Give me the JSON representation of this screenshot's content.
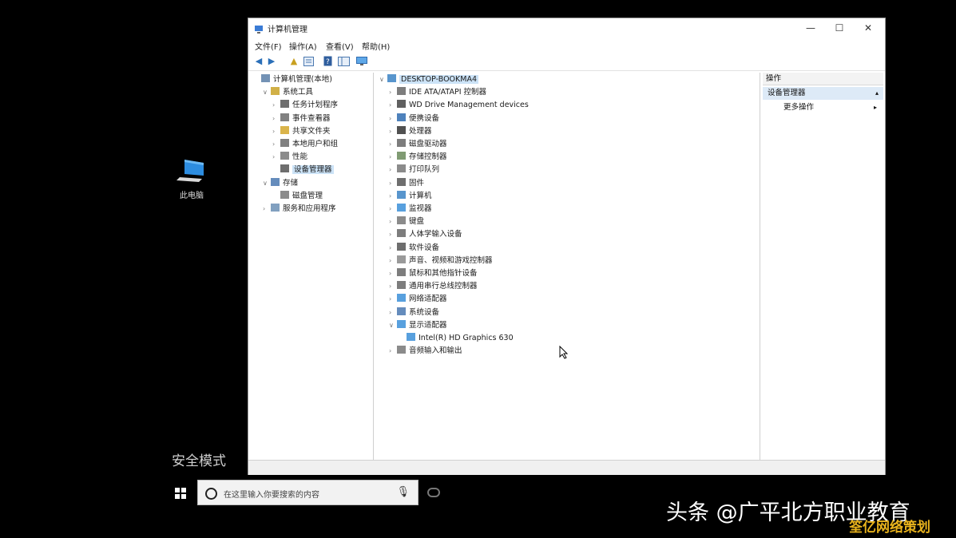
{
  "desktop": {
    "icon_label": "此电脑",
    "safe_mode": "安全模式"
  },
  "window": {
    "title": "计算机管理",
    "controls": {
      "minimize": "—",
      "maximize": "☐",
      "close": "✕"
    },
    "menu": [
      "文件(F)",
      "操作(A)",
      "查看(V)",
      "帮助(H)"
    ],
    "toolbar": [
      "back-icon",
      "forward-icon",
      "up-folder-icon",
      "properties-icon",
      "help-icon",
      "show-hide-tree-icon",
      "monitor-icon"
    ]
  },
  "left_tree": [
    {
      "label": "计算机管理(本地)",
      "indent": 0,
      "arrow": "",
      "icon": "computer-management-icon"
    },
    {
      "label": "系统工具",
      "indent": 1,
      "arrow": "∨",
      "icon": "tools-icon"
    },
    {
      "label": "任务计划程序",
      "indent": 2,
      "arrow": "›",
      "icon": "clock-icon"
    },
    {
      "label": "事件查看器",
      "indent": 2,
      "arrow": "›",
      "icon": "event-viewer-icon"
    },
    {
      "label": "共享文件夹",
      "indent": 2,
      "arrow": "›",
      "icon": "shared-folder-icon"
    },
    {
      "label": "本地用户和组",
      "indent": 2,
      "arrow": "›",
      "icon": "users-icon"
    },
    {
      "label": "性能",
      "indent": 2,
      "arrow": "›",
      "icon": "performance-icon"
    },
    {
      "label": "设备管理器",
      "indent": 2,
      "arrow": "",
      "icon": "device-manager-icon",
      "selected": true
    },
    {
      "label": "存储",
      "indent": 1,
      "arrow": "∨",
      "icon": "storage-icon"
    },
    {
      "label": "磁盘管理",
      "indent": 2,
      "arrow": "",
      "icon": "disk-icon"
    },
    {
      "label": "服务和应用程序",
      "indent": 1,
      "arrow": "›",
      "icon": "services-icon"
    }
  ],
  "device_tree": [
    {
      "label": "DESKTOP-BOOKMA4",
      "indent": 0,
      "arrow": "∨",
      "icon": "computer-icon",
      "selected": true
    },
    {
      "label": "IDE ATA/ATAPI 控制器",
      "indent": 1,
      "arrow": "›",
      "icon": "ide-icon"
    },
    {
      "label": "WD Drive Management devices",
      "indent": 1,
      "arrow": "›",
      "icon": "diamond-icon"
    },
    {
      "label": "便携设备",
      "indent": 1,
      "arrow": "›",
      "icon": "portable-icon"
    },
    {
      "label": "处理器",
      "indent": 1,
      "arrow": "›",
      "icon": "processor-icon"
    },
    {
      "label": "磁盘驱动器",
      "indent": 1,
      "arrow": "›",
      "icon": "disk-drive-icon"
    },
    {
      "label": "存储控制器",
      "indent": 1,
      "arrow": "›",
      "icon": "storage-controller-icon"
    },
    {
      "label": "打印队列",
      "indent": 1,
      "arrow": "›",
      "icon": "printer-icon"
    },
    {
      "label": "固件",
      "indent": 1,
      "arrow": "›",
      "icon": "firmware-icon"
    },
    {
      "label": "计算机",
      "indent": 1,
      "arrow": "›",
      "icon": "computer-icon"
    },
    {
      "label": "监视器",
      "indent": 1,
      "arrow": "›",
      "icon": "monitor-icon"
    },
    {
      "label": "键盘",
      "indent": 1,
      "arrow": "›",
      "icon": "keyboard-icon"
    },
    {
      "label": "人体学输入设备",
      "indent": 1,
      "arrow": "›",
      "icon": "hid-icon"
    },
    {
      "label": "软件设备",
      "indent": 1,
      "arrow": "›",
      "icon": "software-device-icon"
    },
    {
      "label": "声音、视频和游戏控制器",
      "indent": 1,
      "arrow": "›",
      "icon": "sound-icon"
    },
    {
      "label": "鼠标和其他指针设备",
      "indent": 1,
      "arrow": "›",
      "icon": "mouse-icon"
    },
    {
      "label": "通用串行总线控制器",
      "indent": 1,
      "arrow": "›",
      "icon": "usb-icon"
    },
    {
      "label": "网络适配器",
      "indent": 1,
      "arrow": "›",
      "icon": "network-icon"
    },
    {
      "label": "系统设备",
      "indent": 1,
      "arrow": "›",
      "icon": "system-device-icon"
    },
    {
      "label": "显示适配器",
      "indent": 1,
      "arrow": "∨",
      "icon": "display-adapter-icon"
    },
    {
      "label": "Intel(R) HD Graphics 630",
      "indent": 2,
      "arrow": "",
      "icon": "display-adapter-icon"
    },
    {
      "label": "音频输入和输出",
      "indent": 1,
      "arrow": "›",
      "icon": "audio-icon"
    }
  ],
  "actions_pane": {
    "header": "操作",
    "section": "设备管理器",
    "item": "更多操作",
    "item_arrow": "▸",
    "section_arrow": "▴"
  },
  "taskbar": {
    "search_placeholder": "在这里输入你要搜索的内容"
  },
  "watermark": {
    "line1": "头条 @广平北方职业教育",
    "line2": "筌亿网络策划"
  }
}
